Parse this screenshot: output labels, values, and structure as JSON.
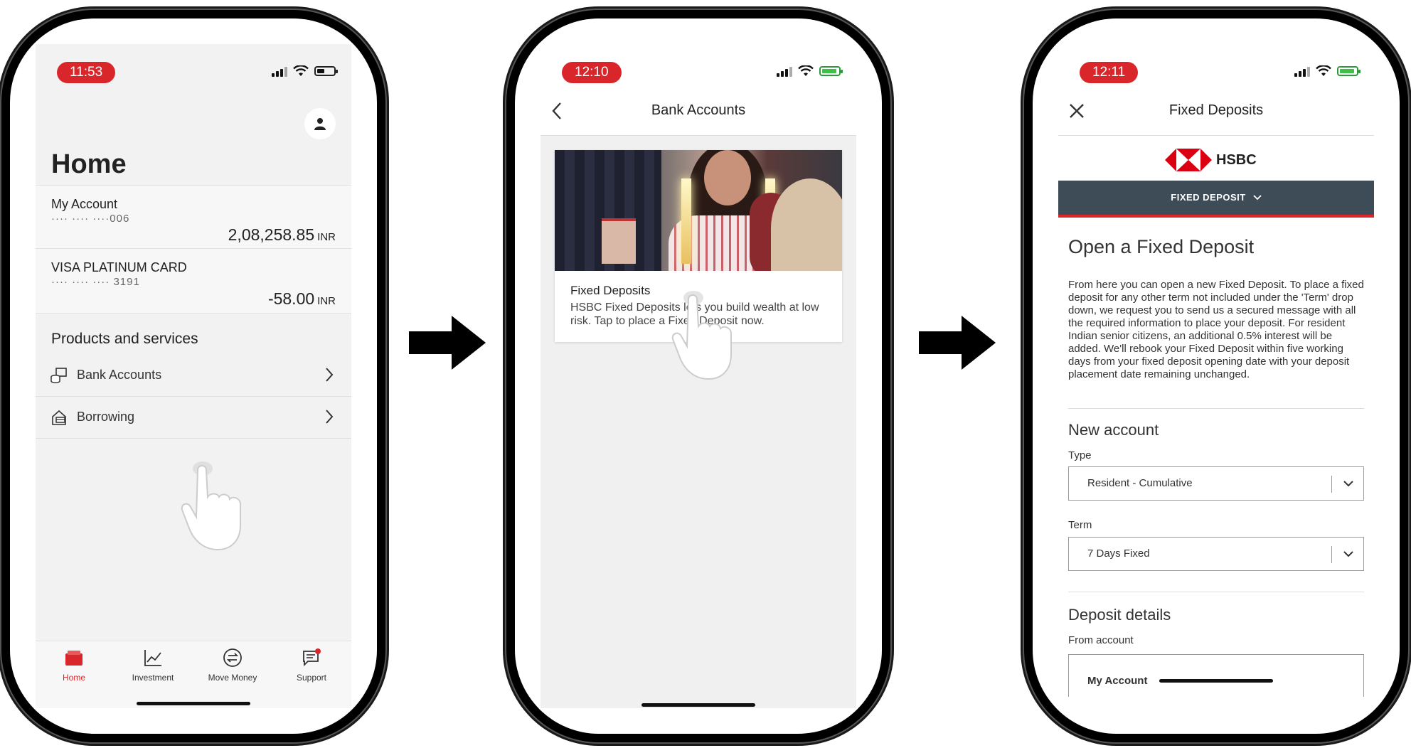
{
  "phones": [
    {
      "time": "11:53",
      "title": "Home",
      "accounts": [
        {
          "name": "My Account",
          "mask": "···· ···· ····006",
          "balance": "2,08,258.85",
          "currency": "INR"
        },
        {
          "name": "VISA PLATINUM CARD",
          "mask": "···· ···· ···· 3191",
          "balance": "-58.00",
          "currency": "INR"
        }
      ],
      "products_title": "Products and services",
      "products": [
        {
          "label": "Bank Accounts",
          "icon": "bank-coins-icon"
        },
        {
          "label": "Borrowing",
          "icon": "borrowing-house-icon"
        }
      ],
      "tabs": [
        {
          "label": "Home",
          "icon": "wallet-icon",
          "active": true
        },
        {
          "label": "Investment",
          "icon": "chart-icon",
          "active": false
        },
        {
          "label": "Move Money",
          "icon": "transfer-icon",
          "active": false
        },
        {
          "label": "Support",
          "icon": "chat-icon",
          "active": false
        }
      ]
    },
    {
      "time": "12:10",
      "title": "Bank Accounts",
      "promo": {
        "title": "Fixed Deposits",
        "description": "HSBC Fixed Deposits lets you build wealth at low risk. Tap to place a Fixed Deposit now."
      }
    },
    {
      "time": "12:11",
      "title": "Fixed Deposits",
      "brand": "HSBC",
      "menu_label": "FIXED DEPOSIT",
      "heading": "Open a Fixed Deposit",
      "paragraph": "From here you can open a new Fixed Deposit. To place a fixed deposit for any other term not included under the 'Term' drop down, we request you to send us a secured message with all the required information to place your deposit. For resident Indian senior citizens, an additional 0.5% interest will be added. We'll rebook your Fixed Deposit within five working days from your fixed deposit opening date with your deposit placement date remaining unchanged.",
      "new_account": {
        "heading": "New account",
        "type_label": "Type",
        "type_value": "Resident - Cumulative",
        "term_label": "Term",
        "term_value": "7 Days Fixed"
      },
      "deposit_details": {
        "heading": "Deposit details",
        "from_label": "From account",
        "from_value": "My Account"
      }
    }
  ],
  "colors": {
    "brand_red": "#d9262b",
    "menu_bar": "#3e4c57"
  }
}
